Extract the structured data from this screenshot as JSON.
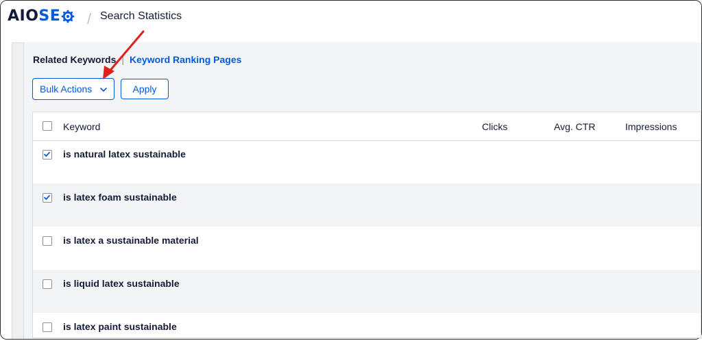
{
  "header": {
    "logo_part1": "AIO",
    "logo_part2": "SE",
    "logo_part3": "",
    "separator": "/",
    "title": "Search Statistics"
  },
  "tabs": {
    "active": "Related Keywords",
    "pipe": "|",
    "other": "Keyword Ranking Pages"
  },
  "toolbar": {
    "bulk_label": "Bulk Actions",
    "apply_label": "Apply"
  },
  "table": {
    "columns": [
      "Keyword",
      "Clicks",
      "Avg. CTR",
      "Impressions"
    ],
    "rows": [
      {
        "keyword": "is natural latex sustainable",
        "checked": true
      },
      {
        "keyword": "is latex foam sustainable",
        "checked": true
      },
      {
        "keyword": "is latex a sustainable material",
        "checked": false
      },
      {
        "keyword": "is liquid latex sustainable",
        "checked": false
      },
      {
        "keyword": "is latex paint sustainable",
        "checked": false
      }
    ]
  },
  "colors": {
    "accent": "#005ae0",
    "annotation_arrow": "#e0201b",
    "text": "#141b38"
  },
  "icons": [
    "gear-icon",
    "chevron-down-icon",
    "checkbox-icon",
    "checkmark-icon",
    "annotation-arrow"
  ]
}
